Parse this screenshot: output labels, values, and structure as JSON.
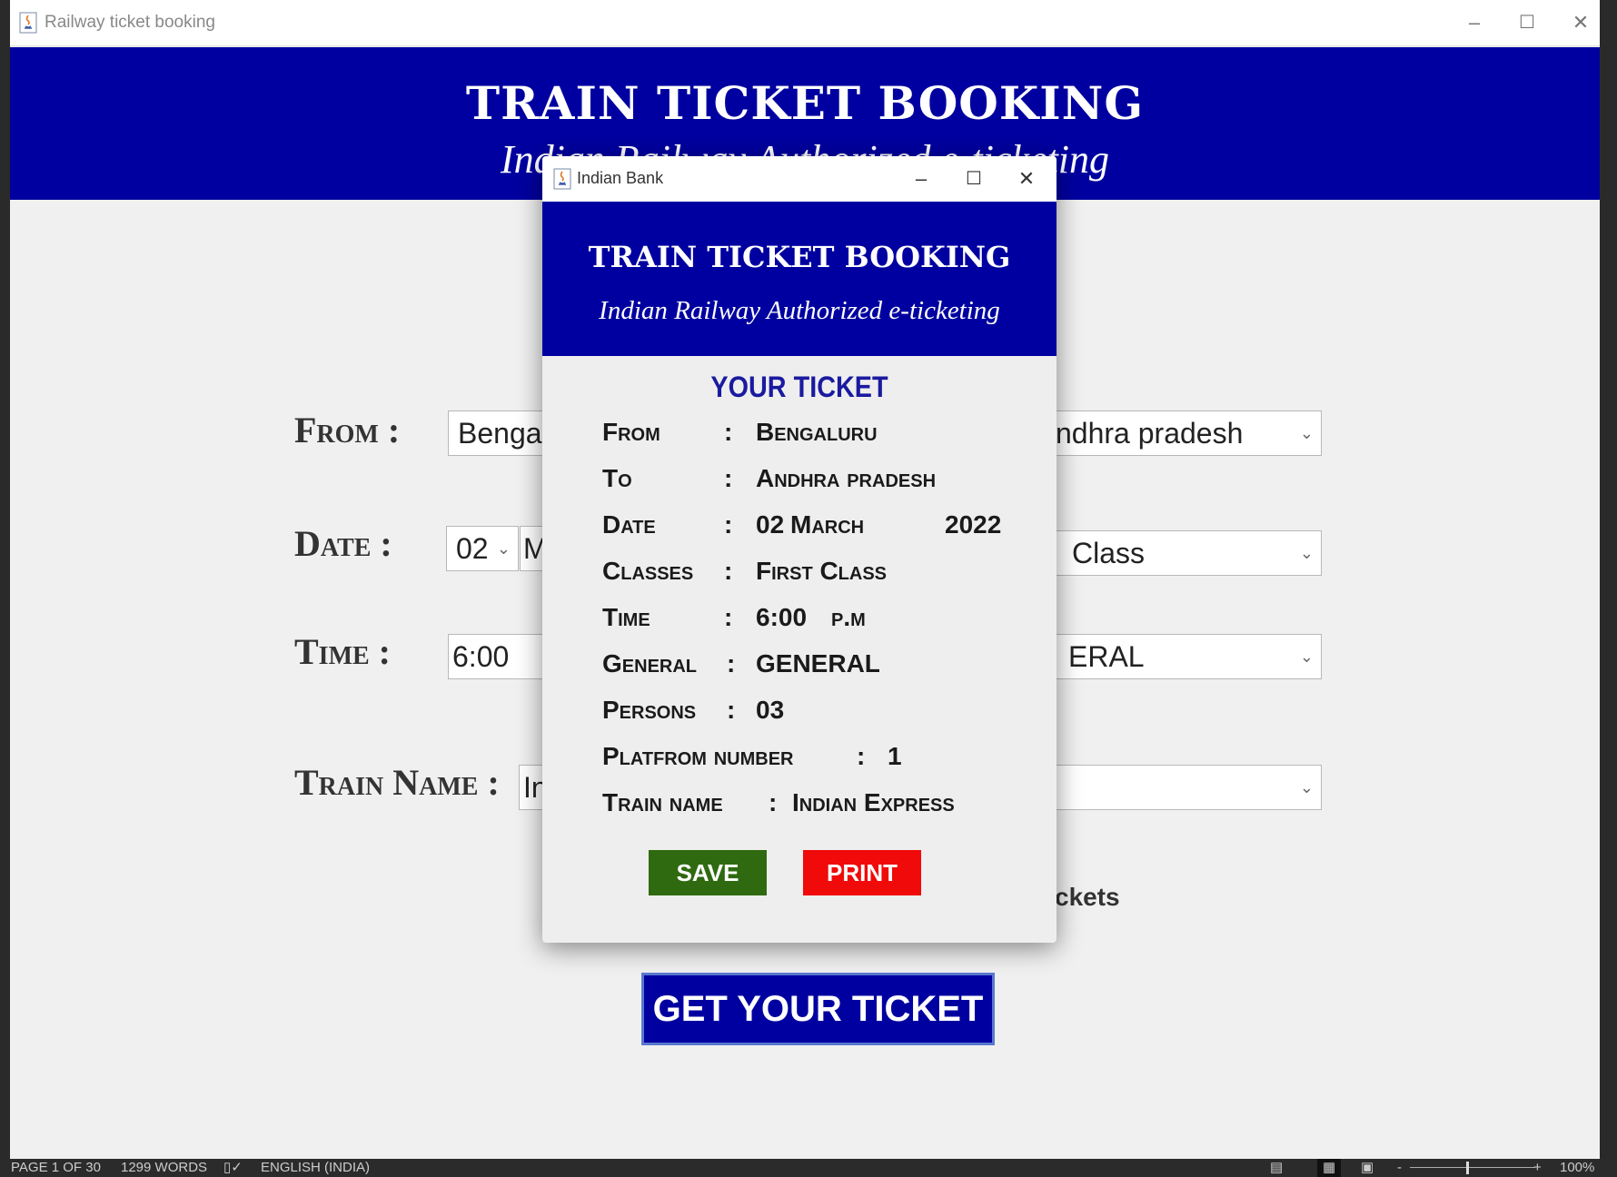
{
  "main_window": {
    "title": "Railway ticket booking",
    "controls": {
      "minimize": "–",
      "maximize": "☐",
      "close": "✕"
    },
    "banner": {
      "title": "TRAIN TICKET BOOKING",
      "subtitle": "Indian Railway Authorized e-ticketing"
    },
    "form": {
      "from_label": "From :",
      "from_value": "Bengalu",
      "to_value": "ndhra pradesh",
      "date_label": "Date :",
      "day_value": "02",
      "month_value": "Ma",
      "class_value": "Class",
      "time_label": "Time :",
      "time_value": "6:00",
      "quota_value": "ERAL",
      "train_name_label": "Train Name :",
      "train_name_value": "In",
      "tickets_text": "ckets"
    },
    "get_ticket_button": "GET YOUR TICKET"
  },
  "dialog": {
    "title": "Indian Bank",
    "controls": {
      "minimize": "–",
      "maximize": "☐",
      "close": "✕"
    },
    "banner": {
      "title": "TRAIN TICKET BOOKING",
      "subtitle": "Indian Railway Authorized e-ticketing"
    },
    "heading": "YOUR TICKET",
    "rows": {
      "from": {
        "label": "From",
        "colon": ":",
        "value": "Bengaluru"
      },
      "to": {
        "label": "To",
        "colon": ":",
        "value": "Andhra pradesh"
      },
      "date": {
        "label": "Date",
        "colon": ":",
        "day": "02",
        "month": "March",
        "year": "2022"
      },
      "classes": {
        "label": "Classes",
        "colon": ":",
        "value": "First Class"
      },
      "time": {
        "label": "Time",
        "colon": ":",
        "value": "6:00",
        "ampm": "p.m"
      },
      "general": {
        "label": "General",
        "colon": ":",
        "value": "GENERAL"
      },
      "persons": {
        "label": "Persons",
        "colon": ":",
        "value": "03"
      },
      "platform": {
        "label": "Platfrom number",
        "colon": ":",
        "value": "1"
      },
      "train": {
        "label": "Train name",
        "colon": ":",
        "value": "Indian Express"
      }
    },
    "save_button": "SAVE",
    "print_button": "PRINT"
  },
  "status_bar": {
    "page": "PAGE 1 OF 30",
    "words": "1299 WORDS",
    "language": "ENGLISH (INDIA)",
    "zoom": "100%"
  },
  "colors": {
    "banner_blue": "#0000a0",
    "save_green": "#2f6a10",
    "print_red": "#f00a0a"
  }
}
